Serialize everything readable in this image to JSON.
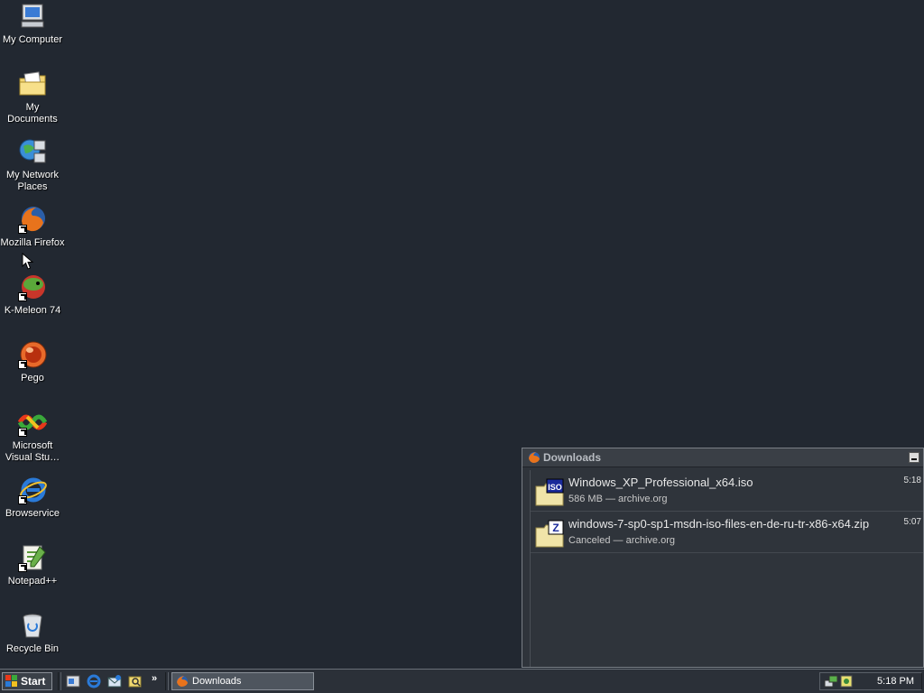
{
  "desktop": {
    "icons": [
      {
        "label": "My Computer",
        "icon": "computer-icon"
      },
      {
        "label": "My Documents",
        "icon": "folder-icon"
      },
      {
        "label": "My Network Places",
        "icon": "network-icon"
      },
      {
        "label": "Mozilla Firefox",
        "icon": "firefox-icon"
      },
      {
        "label": "K-Meleon 74",
        "icon": "kmeleon-icon"
      },
      {
        "label": "Pego",
        "icon": "pego-icon"
      },
      {
        "label": "Microsoft Visual Stu…",
        "icon": "visual-studio-icon"
      },
      {
        "label": "Browservice",
        "icon": "internet-explorer-icon"
      },
      {
        "label": "Notepad++",
        "icon": "notepad-icon"
      },
      {
        "label": "Recycle Bin",
        "icon": "recycle-bin-icon"
      }
    ]
  },
  "downloads_window": {
    "title": "Downloads",
    "items": [
      {
        "name": "Windows_XP_Professional_x64.iso",
        "status": "586 MB — archive.org",
        "time": "5:18",
        "badge": "ISO"
      },
      {
        "name": "windows-7-sp0-sp1-msdn-iso-files-en-de-ru-tr-x86-x64.zip",
        "status": "Canceled — archive.org",
        "time": "5:07",
        "badge": "Z"
      }
    ]
  },
  "taskbar": {
    "start_label": "Start",
    "task_label": "Downloads",
    "clock": "5:18 PM"
  }
}
